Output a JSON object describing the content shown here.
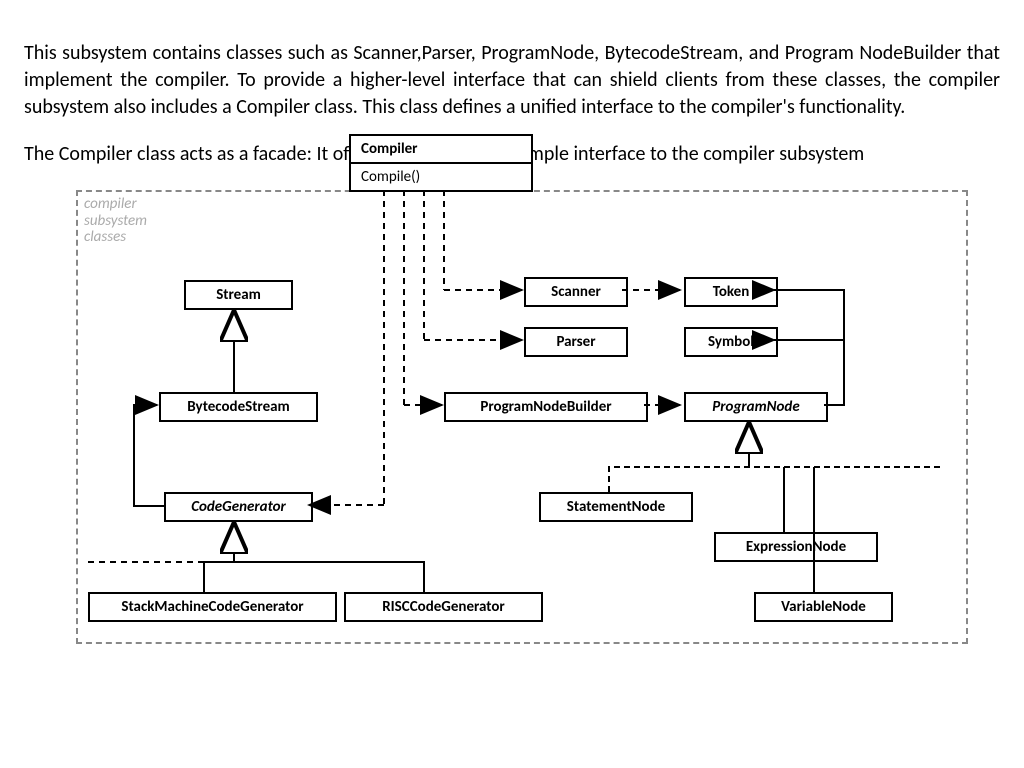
{
  "intro_paragraph": "This subsystem contains classes such as Scanner,Parser, ProgramNode, BytecodeStream, and Program NodeBuilder that implement the compiler. To provide a higher-level interface that can shield clients from these classes, the compiler subsystem also includes a Compiler class. This class defines a unified interface to the compiler's functionality.",
  "second_paragraph": "The Compiler class acts as a facade: It offers clien ts a single, simple interface to the compiler subsystem",
  "subsystem_label": "compiler\nsubsystem\nclasses",
  "compiler": {
    "name": "Compiler",
    "method": "Compile()"
  },
  "classes": {
    "stream": "Stream",
    "bytecode_stream": "BytecodeStream",
    "code_generator": "CodeGenerator",
    "stack_machine_cg": "StackMachineCodeGenerator",
    "risc_cg": "RISCCodeGenerator",
    "scanner": "Scanner",
    "token": "Token",
    "parser": "Parser",
    "symbol": "Symbol",
    "program_node_builder": "ProgramNodeBuilder",
    "program_node": "ProgramNode",
    "statement_node": "StatementNode",
    "expression_node": "ExpressionNode",
    "variable_node": "VariableNode"
  }
}
